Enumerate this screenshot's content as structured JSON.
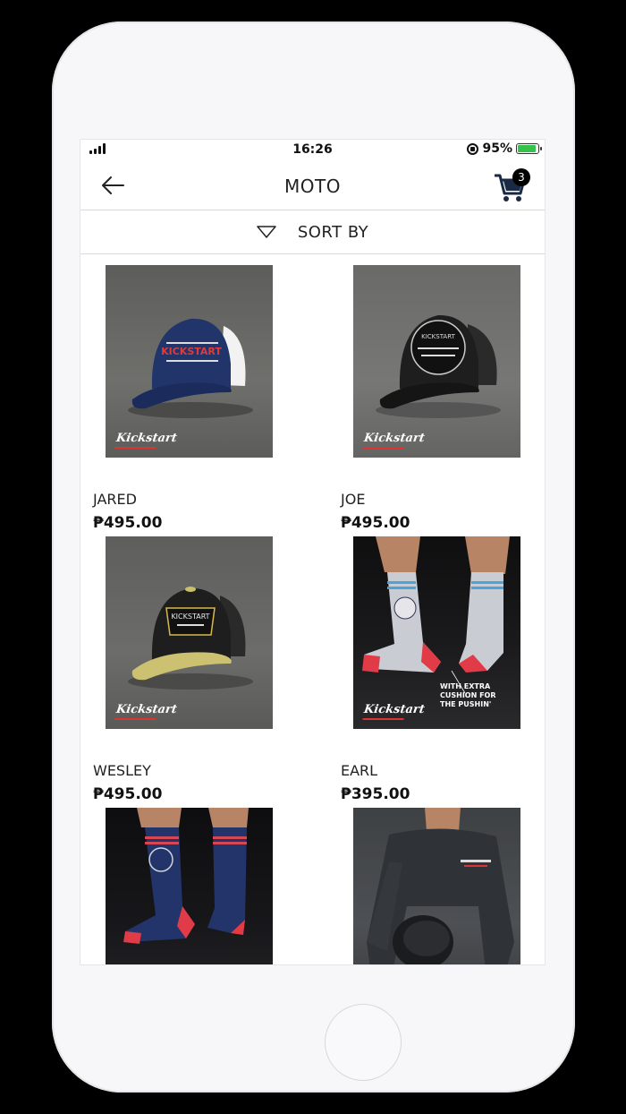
{
  "status_bar": {
    "time": "16:26",
    "battery": "95%"
  },
  "header": {
    "title": "MOTO",
    "cart_count": "3"
  },
  "sort": {
    "label": "SORT BY"
  },
  "products": [
    {
      "name": "JARED",
      "price": "₱495.00",
      "cap_text": "KICKSTART",
      "brand_mark": "Kickstart"
    },
    {
      "name": "JOE",
      "price": "₱495.00",
      "cap_text": "KICKSTART",
      "brand_mark": "Kickstart"
    },
    {
      "name": "WESLEY",
      "price": "₱495.00",
      "cap_text": "KICKSTART",
      "brand_mark": "Kickstart"
    },
    {
      "name": "EARL",
      "price": "₱395.00",
      "brand_mark": "Kickstart",
      "promo": "WITH EXTRA CUSHION FOR THE PUSHIN'"
    },
    {
      "name": "",
      "price": ""
    },
    {
      "name": "",
      "price": ""
    }
  ],
  "colors": {
    "accent": "#111111",
    "battery": "#35c24a"
  }
}
